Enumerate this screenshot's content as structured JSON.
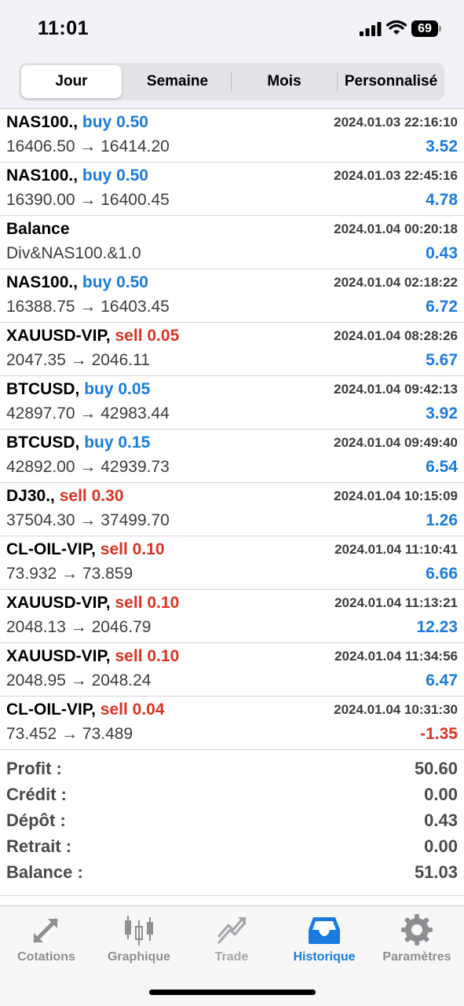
{
  "status": {
    "time": "11:01",
    "battery": "69"
  },
  "segments": [
    "Jour",
    "Semaine",
    "Mois",
    "Personnalisé"
  ],
  "active_segment": "Jour",
  "trades": [
    {
      "symbol": "NAS100.,",
      "type": "buy",
      "lots": "0.50",
      "datetime": "2024.01.03 22:16:10",
      "prices": "16406.50 → 16414.20",
      "profit": "3.52"
    },
    {
      "symbol": "NAS100.,",
      "type": "buy",
      "lots": "0.50",
      "datetime": "2024.01.03 22:45:16",
      "prices": "16390.00 → 16400.45",
      "profit": "4.78"
    },
    {
      "symbol": "Balance",
      "type": "",
      "lots": "",
      "datetime": "2024.01.04 00:20:18",
      "prices": "Div&NAS100.&1.0",
      "profit": "0.43"
    },
    {
      "symbol": "NAS100.,",
      "type": "buy",
      "lots": "0.50",
      "datetime": "2024.01.04 02:18:22",
      "prices": "16388.75 → 16403.45",
      "profit": "6.72"
    },
    {
      "symbol": "XAUUSD-VIP,",
      "type": "sell",
      "lots": "0.05",
      "datetime": "2024.01.04 08:28:26",
      "prices": "2047.35 → 2046.11",
      "profit": "5.67"
    },
    {
      "symbol": "BTCUSD,",
      "type": "buy",
      "lots": "0.05",
      "datetime": "2024.01.04 09:42:13",
      "prices": "42897.70 → 42983.44",
      "profit": "3.92"
    },
    {
      "symbol": "BTCUSD,",
      "type": "buy",
      "lots": "0.15",
      "datetime": "2024.01.04 09:49:40",
      "prices": "42892.00 → 42939.73",
      "profit": "6.54"
    },
    {
      "symbol": "DJ30.,",
      "type": "sell",
      "lots": "0.30",
      "datetime": "2024.01.04 10:15:09",
      "prices": "37504.30 → 37499.70",
      "profit": "1.26"
    },
    {
      "symbol": "CL-OIL-VIP,",
      "type": "sell",
      "lots": "0.10",
      "datetime": "2024.01.04 11:10:41",
      "prices": "73.932 → 73.859",
      "profit": "6.66"
    },
    {
      "symbol": "XAUUSD-VIP,",
      "type": "sell",
      "lots": "0.10",
      "datetime": "2024.01.04 11:13:21",
      "prices": "2048.13 → 2046.79",
      "profit": "12.23"
    },
    {
      "symbol": "XAUUSD-VIP,",
      "type": "sell",
      "lots": "0.10",
      "datetime": "2024.01.04 11:34:56",
      "prices": "2048.95 → 2048.24",
      "profit": "6.47"
    },
    {
      "symbol": "CL-OIL-VIP,",
      "type": "sell",
      "lots": "0.04",
      "datetime": "2024.01.04 10:31:30",
      "prices": "73.452 → 73.489",
      "profit": "-1.35"
    }
  ],
  "summary": [
    {
      "label": "Profit :",
      "value": "50.60"
    },
    {
      "label": "Crédit :",
      "value": "0.00"
    },
    {
      "label": "Dépôt :",
      "value": "0.43"
    },
    {
      "label": "Retrait :",
      "value": "0.00"
    },
    {
      "label": "Balance :",
      "value": "51.03"
    }
  ],
  "tabs": [
    {
      "label": "Cotations",
      "icon": "quotes-arrows-icon"
    },
    {
      "label": "Graphique",
      "icon": "candlestick-chart-icon"
    },
    {
      "label": "Trade",
      "icon": "trade-trend-icon"
    },
    {
      "label": "Historique",
      "icon": "history-inbox-icon"
    },
    {
      "label": "Paramètres",
      "icon": "settings-gear-icon"
    }
  ],
  "active_tab": "Historique",
  "colors": {
    "buy": "#1a7bdf",
    "sell": "#dd3322",
    "accent": "#1a7bdf",
    "inactive": "#8e8e93"
  }
}
